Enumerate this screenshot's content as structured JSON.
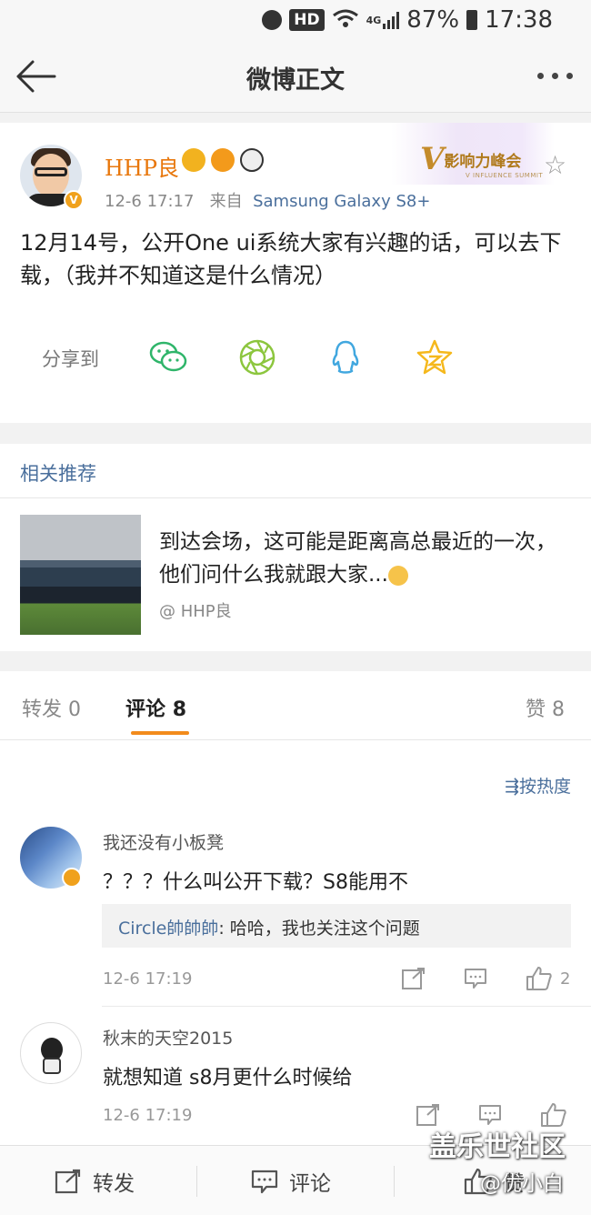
{
  "status_bar": {
    "hd": "HD",
    "network": "4G",
    "battery": "87%",
    "time": "17:38"
  },
  "nav": {
    "title": "微博正文"
  },
  "post": {
    "author": "HHP良",
    "timestamp": "12-6 17:17",
    "from_label": "来自",
    "source": "Samsung Galaxy S8+",
    "badge_v": "V",
    "influence_v": "V",
    "influence_text": "影响力峰会",
    "influence_sub": "V INFLUENCE SUMMIT",
    "text": "12月14号，公开One ui系统大家有兴趣的话，可以去下载，（我并不知道这是什么情况）",
    "share_label": "分享到",
    "share_targets": [
      "wechat-icon",
      "moments-icon",
      "qq-icon",
      "qzone-icon"
    ]
  },
  "related": {
    "title": "相关推荐",
    "item": {
      "text": "到达会场，这可能是距离高总最近的一次，他们问什么我就跟大家...",
      "author": "@ HHP良"
    }
  },
  "tabs": {
    "repost": {
      "label": "转发",
      "count": "0"
    },
    "comments": {
      "label": "评论",
      "count": "8"
    },
    "likes": {
      "label": "赞",
      "count": "8"
    }
  },
  "comments": {
    "sort_label": "按热度",
    "items": [
      {
        "name": "我还没有小板凳",
        "text": "？？？什么叫公开下载？S8能用不",
        "reply_user": "Circle帥帥帥",
        "reply_text": ": 哈哈，我也关注这个问题",
        "time": "12-6 17:19",
        "likes": "2"
      },
      {
        "name": "秋末的天空2015",
        "text": "就想知道 s8月更什么时候给",
        "time": "12-6 17:19"
      }
    ]
  },
  "bottom_bar": {
    "repost": "转发",
    "comment": "评论",
    "like": "赞"
  },
  "watermark": {
    "line1": "盖乐世社区",
    "line2": "@优小白"
  },
  "colors": {
    "orange": "#e8770c",
    "link_blue": "#4a6f9c",
    "tab_underline": "#f28b1c"
  }
}
